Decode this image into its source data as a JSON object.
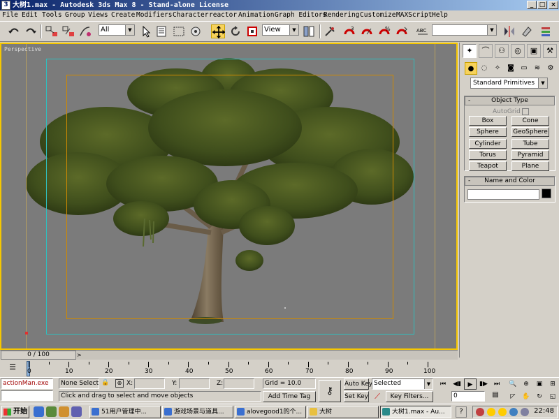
{
  "window": {
    "title": "大树1.max - Autodesk 3ds Max 8  - Stand-alone License",
    "app_icon": "3ds-max-icon",
    "controls": [
      "minimize",
      "maximize",
      "close"
    ]
  },
  "menu": [
    "File",
    "Edit",
    "Tools",
    "Group",
    "Views",
    "Create",
    "Modifiers",
    "Character",
    "reactor",
    "Animation",
    "Graph Editors",
    "Rendering",
    "Customize",
    "MAXScript",
    "Help"
  ],
  "toolbar": {
    "selection_filter": "All",
    "reference_coord": "View",
    "named_selection": ""
  },
  "viewport": {
    "label": "Perspective",
    "active_border_color": "#f6c700",
    "background": "#7b7b7b"
  },
  "command_panel": {
    "category": "Standard Primitives",
    "object_type_title": "Object Type",
    "autogrid_label": "AutoGrid",
    "primitives": [
      "Box",
      "Cone",
      "Sphere",
      "GeoSphere",
      "Cylinder",
      "Tube",
      "Torus",
      "Pyramid",
      "Teapot",
      "Plane"
    ],
    "name_color_title": "Name and Color",
    "object_color": "#000000"
  },
  "timeline": {
    "frame_display": "0 / 100",
    "ticks": [
      "0",
      "10",
      "20",
      "30",
      "40",
      "50",
      "60",
      "70",
      "80",
      "90",
      "100"
    ]
  },
  "status": {
    "maxscript_listener": "actionMan.exe",
    "selection": "None Selecte",
    "x_label": "X:",
    "y_label": "Y:",
    "z_label": "Z:",
    "grid": "Grid = 10.0",
    "prompt": "Click and drag to select and move objects",
    "add_time_tag": "Add Time Tag",
    "auto_key": "Auto Key",
    "set_key": "Set Key",
    "key_mode": "Selected",
    "key_filters": "Key Filters...",
    "current_frame": "0"
  },
  "taskbar": {
    "start_label": "开始",
    "tasks": [
      "51用户管理中...",
      "游戏场景与道具...",
      "alovegood1的个...",
      "大树",
      "大树1.max - Au..."
    ],
    "clock": "22:48"
  }
}
